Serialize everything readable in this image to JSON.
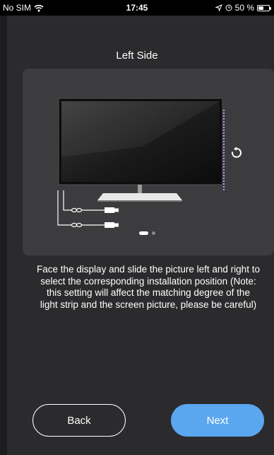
{
  "status_bar": {
    "carrier": "No SIM",
    "time": "17:45",
    "battery": "50 %",
    "battery_level": 0.5
  },
  "header": {
    "title": "Left Side"
  },
  "carousel": {
    "page_count": 2,
    "active_index": 0
  },
  "description": "Face the display and slide the picture left and right to select the corresponding installation position (Note: this setting will affect the matching degree of the light strip and the screen picture, please be careful)",
  "buttons": {
    "back": "Back",
    "next": "Next"
  },
  "colors": {
    "background": "#2b2b2d",
    "card": "#3c3c3e",
    "accent": "#5aa7f0"
  },
  "icons": {
    "wifi": "wifi-icon",
    "location": "location-arrow-icon",
    "alarm": "alarm-icon",
    "battery": "battery-icon",
    "rotate": "rotate-icon",
    "usb": "usb-plug-icon"
  }
}
